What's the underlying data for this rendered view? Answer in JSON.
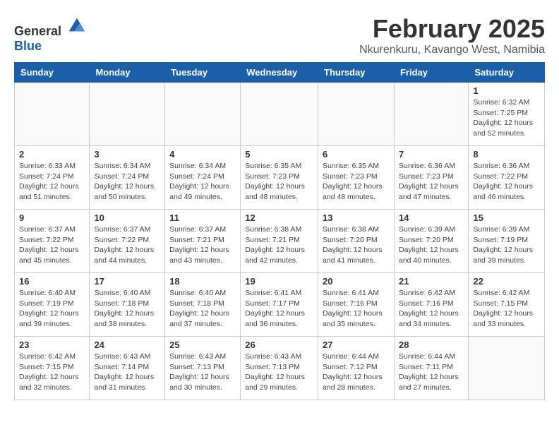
{
  "logo": {
    "general": "General",
    "blue": "Blue"
  },
  "title": "February 2025",
  "subtitle": "Nkurenkuru, Kavango West, Namibia",
  "days_of_week": [
    "Sunday",
    "Monday",
    "Tuesday",
    "Wednesday",
    "Thursday",
    "Friday",
    "Saturday"
  ],
  "weeks": [
    [
      {
        "day": "",
        "info": ""
      },
      {
        "day": "",
        "info": ""
      },
      {
        "day": "",
        "info": ""
      },
      {
        "day": "",
        "info": ""
      },
      {
        "day": "",
        "info": ""
      },
      {
        "day": "",
        "info": ""
      },
      {
        "day": "1",
        "info": "Sunrise: 6:32 AM\nSunset: 7:25 PM\nDaylight: 12 hours\nand 52 minutes."
      }
    ],
    [
      {
        "day": "2",
        "info": "Sunrise: 6:33 AM\nSunset: 7:24 PM\nDaylight: 12 hours\nand 51 minutes."
      },
      {
        "day": "3",
        "info": "Sunrise: 6:34 AM\nSunset: 7:24 PM\nDaylight: 12 hours\nand 50 minutes."
      },
      {
        "day": "4",
        "info": "Sunrise: 6:34 AM\nSunset: 7:24 PM\nDaylight: 12 hours\nand 49 minutes."
      },
      {
        "day": "5",
        "info": "Sunrise: 6:35 AM\nSunset: 7:23 PM\nDaylight: 12 hours\nand 48 minutes."
      },
      {
        "day": "6",
        "info": "Sunrise: 6:35 AM\nSunset: 7:23 PM\nDaylight: 12 hours\nand 48 minutes."
      },
      {
        "day": "7",
        "info": "Sunrise: 6:36 AM\nSunset: 7:23 PM\nDaylight: 12 hours\nand 47 minutes."
      },
      {
        "day": "8",
        "info": "Sunrise: 6:36 AM\nSunset: 7:22 PM\nDaylight: 12 hours\nand 46 minutes."
      }
    ],
    [
      {
        "day": "9",
        "info": "Sunrise: 6:37 AM\nSunset: 7:22 PM\nDaylight: 12 hours\nand 45 minutes."
      },
      {
        "day": "10",
        "info": "Sunrise: 6:37 AM\nSunset: 7:22 PM\nDaylight: 12 hours\nand 44 minutes."
      },
      {
        "day": "11",
        "info": "Sunrise: 6:37 AM\nSunset: 7:21 PM\nDaylight: 12 hours\nand 43 minutes."
      },
      {
        "day": "12",
        "info": "Sunrise: 6:38 AM\nSunset: 7:21 PM\nDaylight: 12 hours\nand 42 minutes."
      },
      {
        "day": "13",
        "info": "Sunrise: 6:38 AM\nSunset: 7:20 PM\nDaylight: 12 hours\nand 41 minutes."
      },
      {
        "day": "14",
        "info": "Sunrise: 6:39 AM\nSunset: 7:20 PM\nDaylight: 12 hours\nand 40 minutes."
      },
      {
        "day": "15",
        "info": "Sunrise: 6:39 AM\nSunset: 7:19 PM\nDaylight: 12 hours\nand 39 minutes."
      }
    ],
    [
      {
        "day": "16",
        "info": "Sunrise: 6:40 AM\nSunset: 7:19 PM\nDaylight: 12 hours\nand 39 minutes."
      },
      {
        "day": "17",
        "info": "Sunrise: 6:40 AM\nSunset: 7:18 PM\nDaylight: 12 hours\nand 38 minutes."
      },
      {
        "day": "18",
        "info": "Sunrise: 6:40 AM\nSunset: 7:18 PM\nDaylight: 12 hours\nand 37 minutes."
      },
      {
        "day": "19",
        "info": "Sunrise: 6:41 AM\nSunset: 7:17 PM\nDaylight: 12 hours\nand 36 minutes."
      },
      {
        "day": "20",
        "info": "Sunrise: 6:41 AM\nSunset: 7:16 PM\nDaylight: 12 hours\nand 35 minutes."
      },
      {
        "day": "21",
        "info": "Sunrise: 6:42 AM\nSunset: 7:16 PM\nDaylight: 12 hours\nand 34 minutes."
      },
      {
        "day": "22",
        "info": "Sunrise: 6:42 AM\nSunset: 7:15 PM\nDaylight: 12 hours\nand 33 minutes."
      }
    ],
    [
      {
        "day": "23",
        "info": "Sunrise: 6:42 AM\nSunset: 7:15 PM\nDaylight: 12 hours\nand 32 minutes."
      },
      {
        "day": "24",
        "info": "Sunrise: 6:43 AM\nSunset: 7:14 PM\nDaylight: 12 hours\nand 31 minutes."
      },
      {
        "day": "25",
        "info": "Sunrise: 6:43 AM\nSunset: 7:13 PM\nDaylight: 12 hours\nand 30 minutes."
      },
      {
        "day": "26",
        "info": "Sunrise: 6:43 AM\nSunset: 7:13 PM\nDaylight: 12 hours\nand 29 minutes."
      },
      {
        "day": "27",
        "info": "Sunrise: 6:44 AM\nSunset: 7:12 PM\nDaylight: 12 hours\nand 28 minutes."
      },
      {
        "day": "28",
        "info": "Sunrise: 6:44 AM\nSunset: 7:11 PM\nDaylight: 12 hours\nand 27 minutes."
      },
      {
        "day": "",
        "info": ""
      }
    ]
  ]
}
